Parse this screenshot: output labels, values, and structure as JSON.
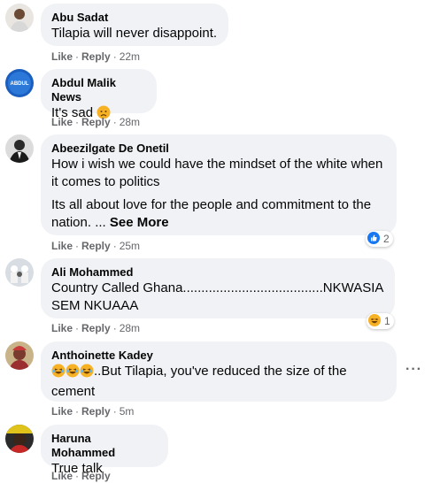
{
  "comments": [
    {
      "name": "Abu Sadat",
      "text": "Tilapia will never disappoint.",
      "like": "Like",
      "reply": "Reply",
      "time": "22m"
    },
    {
      "name": "Abdul Malik News",
      "text": "It's sad",
      "avatar_text": "ABDUL",
      "like": "Like",
      "reply": "Reply",
      "time": "28m"
    },
    {
      "name": "Abeezilgate De Onetil",
      "text_p1": "How i wish we could have the mindset of the white when it comes to politics",
      "text_p2": "Its all about love for the people and commitment to the nation. ...",
      "see_more": "See More",
      "like": "Like",
      "reply": "Reply",
      "time": "25m",
      "reaction_icon": "like-icon",
      "reaction_count": "2"
    },
    {
      "name": "Ali Mohammed",
      "text": "Country Called Ghana......................................NKWASIA SEM NKUAAA",
      "like": "Like",
      "reply": "Reply",
      "time": "28m",
      "reaction_icon": "haha-icon",
      "reaction_count": "1"
    },
    {
      "name": "Anthoinette Kadey",
      "text": "..But Tilapia, you've reduced the size of the cement",
      "like": "Like",
      "reply": "Reply",
      "time": "5m",
      "more_icon": "more-options-icon"
    },
    {
      "name": "Haruna Mohammed",
      "text": "True talk",
      "like": "Like",
      "reply": "Reply"
    }
  ],
  "colors": {
    "bubble": "#f0f2f5",
    "meta": "#65676b",
    "like_blue": "#1877f2",
    "haha_yellow": "#f7b125"
  }
}
